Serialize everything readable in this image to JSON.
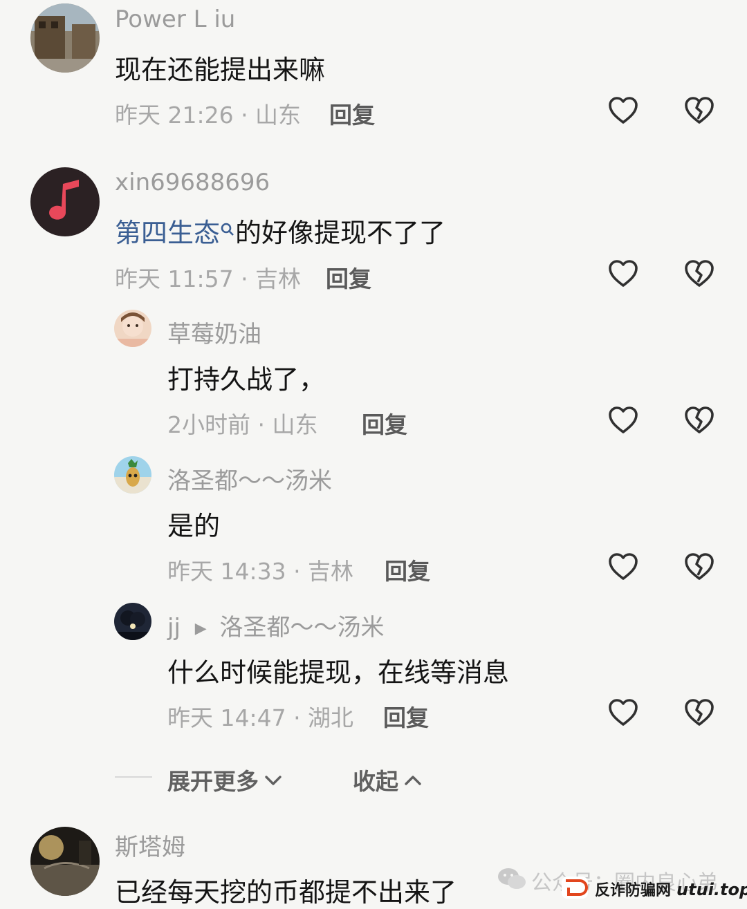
{
  "comments": [
    {
      "username": "Power L iu",
      "content": "现在还能提出来嘛",
      "meta": "昨天 21:26 · 山东",
      "reply": "回复"
    },
    {
      "username": "xin69688696",
      "topic": "第四生态",
      "content": "的好像提现不了了",
      "meta": "昨天 11:57 · 吉林",
      "reply": "回复"
    },
    {
      "username": "草莓奶油",
      "content": "打持久战了，",
      "meta": "2小时前 · 山东",
      "reply": "回复"
    },
    {
      "username": "洛圣都～～汤米",
      "content": "是的",
      "meta": "昨天 14:33 · 吉林",
      "reply": "回复"
    },
    {
      "username": "jj",
      "reply_to": "洛圣都～～汤米",
      "content": "什么时候能提现，在线等消息",
      "meta": "昨天 14:47 · 湖北",
      "reply": "回复"
    },
    {
      "username": "斯塔姆",
      "content": "已经每天挖的币都提不出来了"
    }
  ],
  "thread_controls": {
    "expand": "展开更多",
    "collapse": "收起"
  },
  "watermark": {
    "wechat": "公众号：圈内良心弟",
    "site_cn": "反诈防骗网",
    "site_url": "utui.top"
  },
  "colors": {
    "background": "#f6f6f4",
    "topic_link": "#3a5e93",
    "watermark_brand": "#e2461e"
  },
  "icons": {
    "like": "heart-outline-icon",
    "dislike": "broken-heart-icon"
  }
}
